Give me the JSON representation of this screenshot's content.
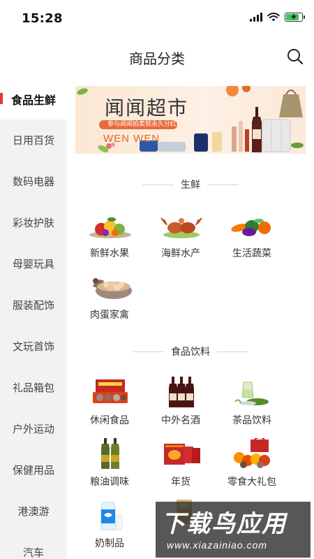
{
  "status_bar": {
    "time": "15:28",
    "icons": [
      "signal-icon",
      "wifi-icon",
      "battery-charging-icon"
    ],
    "battery_level": 0.85
  },
  "header": {
    "title": "商品分类",
    "search_icon": "search-icon"
  },
  "sidebar": {
    "items": [
      {
        "label": "食品生鲜",
        "active": true
      },
      {
        "label": "日用百货"
      },
      {
        "label": "数码电器"
      },
      {
        "label": "彩妆护肤"
      },
      {
        "label": "母婴玩具"
      },
      {
        "label": "服装配饰"
      },
      {
        "label": "文玩首饰"
      },
      {
        "label": "礼品箱包"
      },
      {
        "label": "户外运动"
      },
      {
        "label": "保健用品"
      },
      {
        "label": "港澳游"
      },
      {
        "label": "汽车"
      }
    ]
  },
  "banner": {
    "title": "闻闻超市",
    "ribbon_text": "参与闻闻拍卖就永久分红",
    "brand": "WEN WEN"
  },
  "sections": [
    {
      "title": "生鲜",
      "items": [
        {
          "label": "新鲜水果",
          "icon": "fruit-icon"
        },
        {
          "label": "海鲜水产",
          "icon": "seafood-icon"
        },
        {
          "label": "生活蔬菜",
          "icon": "vegetable-icon"
        },
        {
          "label": "肉蛋家禽",
          "icon": "eggs-poultry-icon"
        }
      ]
    },
    {
      "title": "食品饮料",
      "items": [
        {
          "label": "休闲食品",
          "icon": "snack-box-icon"
        },
        {
          "label": "中外名酒",
          "icon": "wine-bottles-icon"
        },
        {
          "label": "茶品饮料",
          "icon": "tea-icon"
        },
        {
          "label": "粮油调味",
          "icon": "oil-bottles-icon"
        },
        {
          "label": "年货",
          "icon": "gift-boxes-icon"
        },
        {
          "label": "零食大礼包",
          "icon": "snack-gift-pack-icon"
        },
        {
          "label": "奶制品",
          "icon": "milk-icon"
        },
        {
          "label": "",
          "icon": "box-icon"
        }
      ]
    }
  ],
  "watermark": {
    "main": "下载鸟应用",
    "sub": "www.xiazainiao.com"
  }
}
